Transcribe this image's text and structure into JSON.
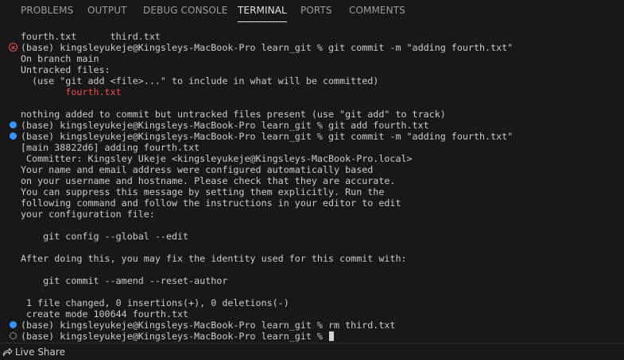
{
  "panel_tabs": [
    {
      "label": "PROBLEMS",
      "active": false
    },
    {
      "label": "OUTPUT",
      "active": false
    },
    {
      "label": "DEBUG CONSOLE",
      "active": false
    },
    {
      "label": "TERMINAL",
      "active": true
    },
    {
      "label": "PORTS",
      "active": false
    },
    {
      "label": "COMMENTS",
      "active": false
    }
  ],
  "terminal": {
    "lines": [
      {
        "text": "fourth.txt      third.txt",
        "decoration": "none"
      },
      {
        "text": "(base) kingsleyukeje@Kingsleys-MacBook-Pro learn_git % git commit -m \"adding fourth.txt\"",
        "decoration": "error"
      },
      {
        "text": "On branch main",
        "decoration": "none"
      },
      {
        "text": "Untracked files:",
        "decoration": "none"
      },
      {
        "text": "  (use \"git add <file>...\" to include in what will be committed)",
        "decoration": "none"
      },
      {
        "text": "        fourth.txt",
        "decoration": "none",
        "color": "red"
      },
      {
        "text": "",
        "decoration": "none"
      },
      {
        "text": "nothing added to commit but untracked files present (use \"git add\" to track)",
        "decoration": "none"
      },
      {
        "text": "(base) kingsleyukeje@Kingsleys-MacBook-Pro learn_git % git add fourth.txt",
        "decoration": "success"
      },
      {
        "text": "(base) kingsleyukeje@Kingsleys-MacBook-Pro learn_git % git commit -m \"adding fourth.txt\"",
        "decoration": "success"
      },
      {
        "text": "[main 38822d6] adding fourth.txt",
        "decoration": "none"
      },
      {
        "text": " Committer: Kingsley Ukeje <kingsleyukeje@Kingsleys-MacBook-Pro.local>",
        "decoration": "none"
      },
      {
        "text": "Your name and email address were configured automatically based",
        "decoration": "none"
      },
      {
        "text": "on your username and hostname. Please check that they are accurate.",
        "decoration": "none"
      },
      {
        "text": "You can suppress this message by setting them explicitly. Run the",
        "decoration": "none"
      },
      {
        "text": "following command and follow the instructions in your editor to edit",
        "decoration": "none"
      },
      {
        "text": "your configuration file:",
        "decoration": "none"
      },
      {
        "text": "",
        "decoration": "none"
      },
      {
        "text": "    git config --global --edit",
        "decoration": "none"
      },
      {
        "text": "",
        "decoration": "none"
      },
      {
        "text": "After doing this, you may fix the identity used for this commit with:",
        "decoration": "none"
      },
      {
        "text": "",
        "decoration": "none"
      },
      {
        "text": "    git commit --amend --reset-author",
        "decoration": "none"
      },
      {
        "text": "",
        "decoration": "none"
      },
      {
        "text": " 1 file changed, 0 insertions(+), 0 deletions(-)",
        "decoration": "none"
      },
      {
        "text": " create mode 100644 fourth.txt",
        "decoration": "none"
      },
      {
        "text": "(base) kingsleyukeje@Kingsleys-MacBook-Pro learn_git % rm third.txt",
        "decoration": "success"
      },
      {
        "text": "(base) kingsleyukeje@Kingsleys-MacBook-Pro learn_git % ",
        "decoration": "pending",
        "cursor": true
      }
    ]
  },
  "statusbar": {
    "live_share_label": "Live Share",
    "live_share_icon": "live-share-icon"
  },
  "colors": {
    "background": "#181818",
    "text": "#cccccc",
    "tab_inactive": "#9d9d9d",
    "tab_active": "#e7e7e7",
    "error": "#f14c4c",
    "success_dot": "#3794ff",
    "pending_dot": "#8b8b8b"
  }
}
